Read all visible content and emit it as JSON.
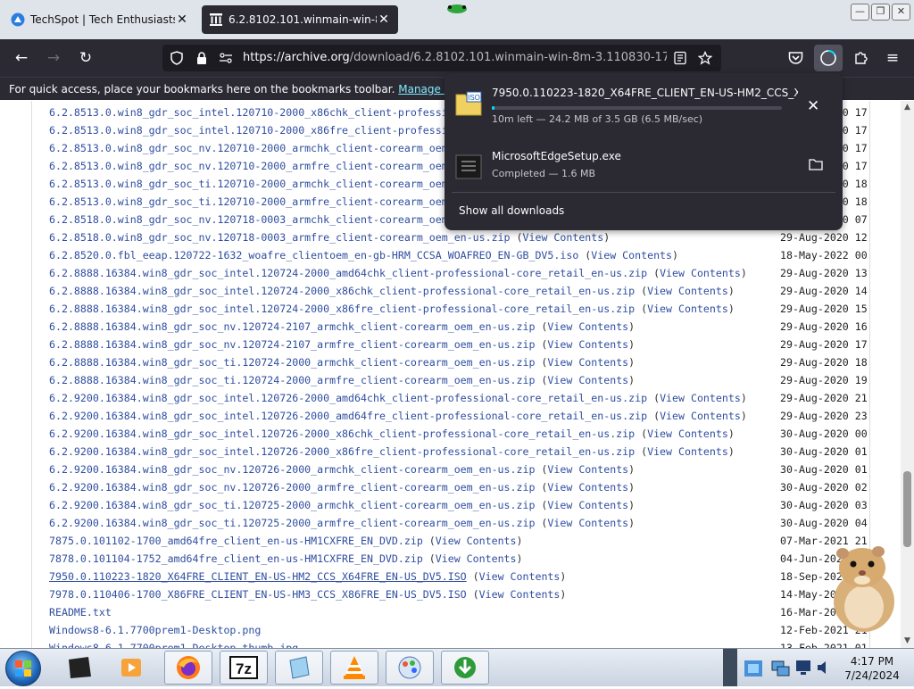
{
  "tabs": [
    {
      "title": "TechSpot | Tech Enthusiasts, Po",
      "close": "✕"
    },
    {
      "title": "6.2.8102.101.winmain-win-8m-",
      "close": "✕"
    }
  ],
  "toolbar": {
    "url_host": "https://archive.org",
    "url_rest": "/download/6.2.8102.101.winmain-win-8m-3.110830-1739",
    "back": "←",
    "forward": "→",
    "reload": "↻",
    "menu": "≡"
  },
  "bookmarks_bar": {
    "text": "For quick access, place your bookmarks here on the bookmarks toolbar.",
    "link": "Manage bookmarks..."
  },
  "files": [
    {
      "name": "6.2.8513.0.win8_gdr_soc_intel.120710-2000_x86chk_client-professional-core_retail_en-us.zip",
      "view": "View Contents",
      "date": "29-Aug-2020 17"
    },
    {
      "name": "6.2.8513.0.win8_gdr_soc_intel.120710-2000_x86fre_client-professional-core_retail_en-us.zip",
      "view": "View Contents",
      "date": "29-Aug-2020 17"
    },
    {
      "name": "6.2.8513.0.win8_gdr_soc_nv.120710-2000_armchk_client-corearm_oem_en-us.zip",
      "view": "View Contents",
      "date": "29-Aug-2020 17"
    },
    {
      "name": "6.2.8513.0.win8_gdr_soc_nv.120710-2000_armfre_client-corearm_oem_en-us.zip",
      "view": "View Contents",
      "date": "29-Aug-2020 17"
    },
    {
      "name": "6.2.8513.0.win8_gdr_soc_ti.120710-2000_armchk_client-corearm_oem_en-us.zip",
      "view": "View Contents",
      "date": "29-Aug-2020 18"
    },
    {
      "name": "6.2.8513.0.win8_gdr_soc_ti.120710-2000_armfre_client-corearm_oem_en-us.zip",
      "view": "View Contents",
      "date": "29-Aug-2020 18"
    },
    {
      "name": "6.2.8518.0.win8_gdr_soc_nv.120718-0003_armchk_client-corearm_oem_en-us.zip",
      "view": "View Contents",
      "date": "30-Aug-2020 07"
    },
    {
      "name": "6.2.8518.0.win8_gdr_soc_nv.120718-0003_armfre_client-corearm_oem_en-us.zip",
      "view": "View Contents",
      "date": "29-Aug-2020 12"
    },
    {
      "name": "6.2.8520.0.fbl_eeap.120722-1632_woafre_clientoem_en-gb-HRM_CCSA_WOAFREO_EN-GB_DV5.iso",
      "view": "View Contents",
      "date": "18-May-2022 00"
    },
    {
      "name": "6.2.8888.16384.win8_gdr_soc_intel.120724-2000_amd64chk_client-professional-core_retail_en-us.zip",
      "view": "View Contents",
      "date": "29-Aug-2020 13"
    },
    {
      "name": "6.2.8888.16384.win8_gdr_soc_intel.120724-2000_x86chk_client-professional-core_retail_en-us.zip",
      "view": "View Contents",
      "date": "29-Aug-2020 14"
    },
    {
      "name": "6.2.8888.16384.win8_gdr_soc_intel.120724-2000_x86fre_client-professional-core_retail_en-us.zip",
      "view": "View Contents",
      "date": "29-Aug-2020 15"
    },
    {
      "name": "6.2.8888.16384.win8_gdr_soc_nv.120724-2107_armchk_client-corearm_oem_en-us.zip",
      "view": "View Contents",
      "date": "29-Aug-2020 16"
    },
    {
      "name": "6.2.8888.16384.win8_gdr_soc_nv.120724-2107_armfre_client-corearm_oem_en-us.zip",
      "view": "View Contents",
      "date": "29-Aug-2020 17"
    },
    {
      "name": "6.2.8888.16384.win8_gdr_soc_ti.120724-2000_armchk_client-corearm_oem_en-us.zip",
      "view": "View Contents",
      "date": "29-Aug-2020 18"
    },
    {
      "name": "6.2.8888.16384.win8_gdr_soc_ti.120724-2000_armfre_client-corearm_oem_en-us.zip",
      "view": "View Contents",
      "date": "29-Aug-2020 19"
    },
    {
      "name": "6.2.9200.16384.win8_gdr_soc_intel.120726-2000_amd64chk_client-professional-core_retail_en-us.zip",
      "view": "View Contents",
      "date": "29-Aug-2020 21"
    },
    {
      "name": "6.2.9200.16384.win8_gdr_soc_intel.120726-2000_amd64fre_client-professional-core_retail_en-us.zip",
      "view": "View Contents",
      "date": "29-Aug-2020 23"
    },
    {
      "name": "6.2.9200.16384.win8_gdr_soc_intel.120726-2000_x86chk_client-professional-core_retail_en-us.zip",
      "view": "View Contents",
      "date": "30-Aug-2020 00"
    },
    {
      "name": "6.2.9200.16384.win8_gdr_soc_intel.120726-2000_x86fre_client-professional-core_retail_en-us.zip",
      "view": "View Contents",
      "date": "30-Aug-2020 01"
    },
    {
      "name": "6.2.9200.16384.win8_gdr_soc_nv.120726-2000_armchk_client-corearm_oem_en-us.zip",
      "view": "View Contents",
      "date": "30-Aug-2020 01"
    },
    {
      "name": "6.2.9200.16384.win8_gdr_soc_nv.120726-2000_armfre_client-corearm_oem_en-us.zip",
      "view": "View Contents",
      "date": "30-Aug-2020 02"
    },
    {
      "name": "6.2.9200.16384.win8_gdr_soc_ti.120725-2000_armchk_client-corearm_oem_en-us.zip",
      "view": "View Contents",
      "date": "30-Aug-2020 03"
    },
    {
      "name": "6.2.9200.16384.win8_gdr_soc_ti.120725-2000_armfre_client-corearm_oem_en-us.zip",
      "view": "View Contents",
      "date": "30-Aug-2020 04"
    },
    {
      "name": "7875.0.101102-1700_amd64fre_client_en-us-HM1CXFRE_EN_DVD.zip",
      "view": "View Contents",
      "date": "07-Mar-2021 21"
    },
    {
      "name": "7878.0.101104-1752_amd64fre_client_en-us-HM1CXFRE_EN_DVD.zip",
      "view": "View Contents",
      "date": "04-Jun-2021 21"
    },
    {
      "name": "7950.0.110223-1820_X64FRE_CLIENT_EN-US-HM2_CCS_X64FRE_EN-US_DV5.ISO",
      "view": "View Contents",
      "date": "18-Sep-2023 21"
    },
    {
      "name": "7978.0.110406-1700_X86FRE_CLIENT_EN-US-HM3_CCS_X86FRE_EN-US_DV5.ISO",
      "view": "View Contents",
      "date": "14-May-2023 21"
    },
    {
      "name": "README.txt",
      "view": "",
      "date": "16-Mar-2023 21"
    },
    {
      "name": "Windows8-6.1.7700prem1-Desktop.png",
      "view": "",
      "date": "12-Feb-2021 21"
    },
    {
      "name": "Windows8-6.1.7700prem1-Desktop_thumb.jpg",
      "view": "",
      "date": "13-Feb-2021 01"
    }
  ],
  "downloads_panel": {
    "items": [
      {
        "name": "7950.0.110223-1820_X64FRE_CLIENT_EN-US-HM2_CCS_X64FRE_EN-US_DV5.ISO",
        "status": "10m left — 24.2 MB of 3.5 GB (6.5 MB/sec)",
        "progress": 0.007
      },
      {
        "name": "MicrosoftEdgeSetup.exe",
        "status": "Completed — 1.6 MB"
      }
    ],
    "show_all": "Show all downloads"
  },
  "taskbar": {
    "apps": [
      "desktop-app",
      "media-player",
      "firefox",
      "7-zip",
      "notepad",
      "vlc",
      "paint",
      "internet-download-manager"
    ],
    "time": "4:17 PM",
    "date": "7/24/2024"
  },
  "colors": {
    "link": "#2f4ea0",
    "toolbar": "#2b2a33",
    "accent": "#00ddff"
  }
}
